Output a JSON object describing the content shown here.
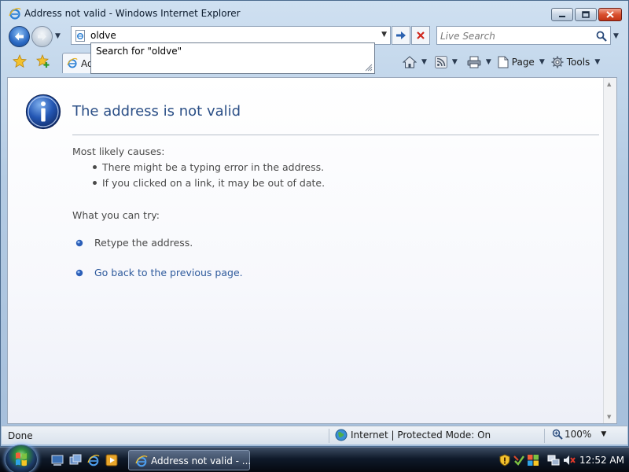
{
  "window": {
    "title": "Address not valid - Windows Internet Explorer"
  },
  "address": {
    "value": "oldve",
    "suggestion": "Search for \"oldve\""
  },
  "search": {
    "placeholder": "Live Search"
  },
  "tab": {
    "label": "Address not valid"
  },
  "commands": {
    "page_label": "Page",
    "tools_label": "Tools"
  },
  "page": {
    "title": "The address is not valid",
    "causes_heading": "Most likely causes:",
    "causes": [
      "There might be a typing error in the address.",
      "If you clicked on a link, it may be out of date."
    ],
    "try_heading": "What you can try:",
    "try_items": [
      "Retype the address.",
      "Go back to the previous page."
    ]
  },
  "status": {
    "text": "Done",
    "zone": "Internet | Protected Mode: On",
    "zoom": "100%"
  },
  "taskbar": {
    "task_label": "Address not valid - ...",
    "clock": "12:52 AM"
  },
  "colors": {
    "title_blue": "#2b4f86",
    "link_blue": "#2e5a9c",
    "close_red": "#c23516"
  }
}
